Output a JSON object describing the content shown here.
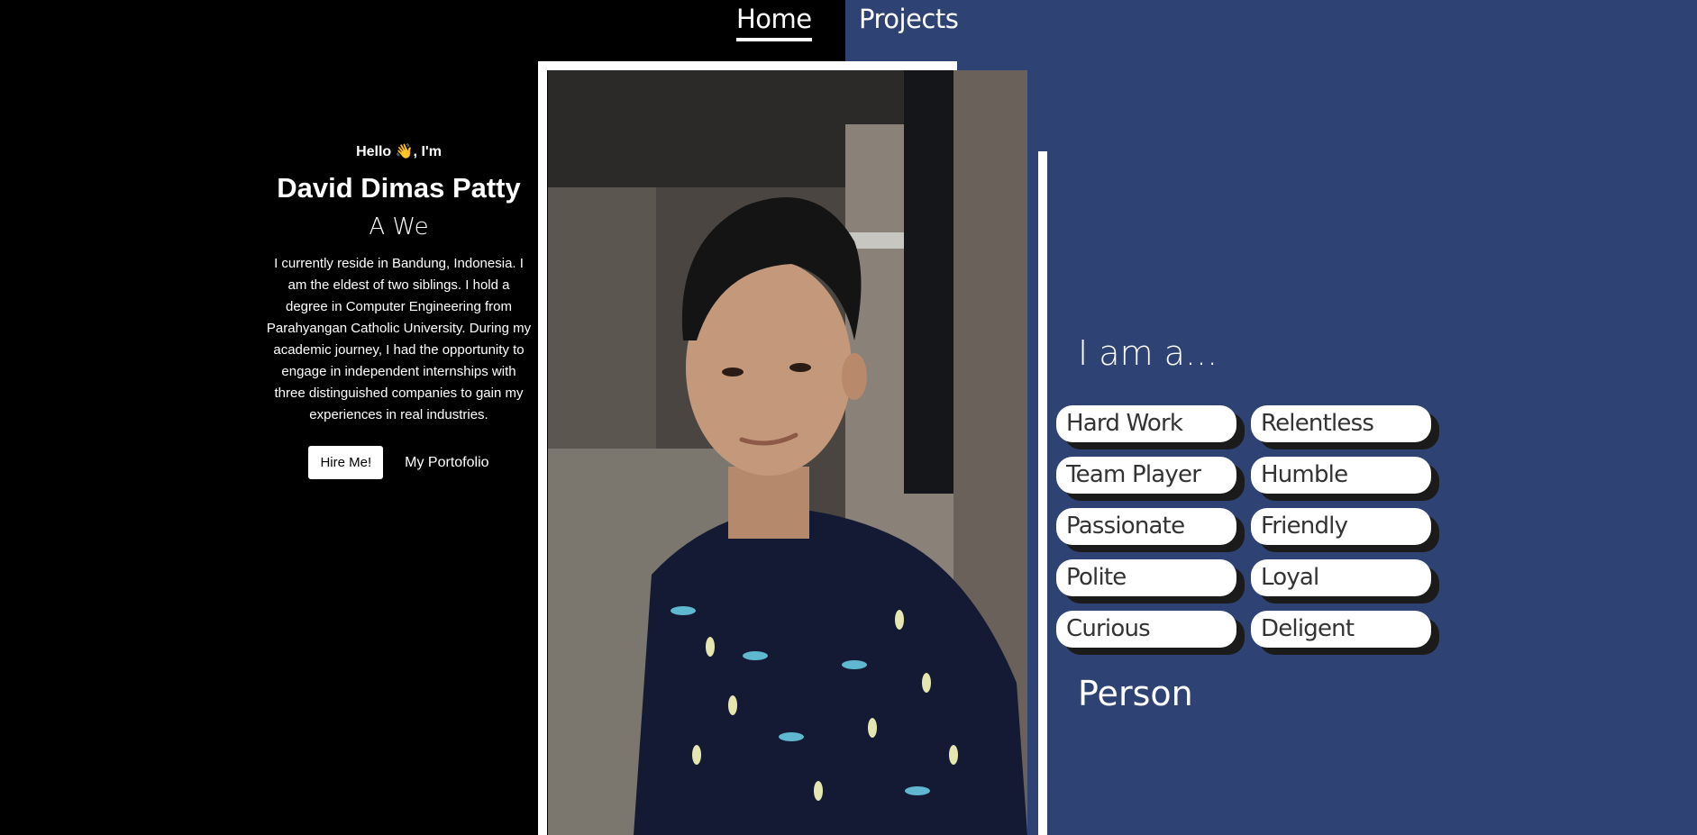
{
  "nav": {
    "home": "Home",
    "projects": "Projects"
  },
  "intro": {
    "greeting": "Hello 👋, I'm",
    "name": "David Dimas Patty",
    "role": "A We",
    "bio": "I currently reside in Bandung, Indonesia. I am the eldest of two siblings. I hold a degree in Computer Engineering from Parahyangan Catholic University. During my academic journey, I had the opportunity to engage in independent internships with three distinguished companies to gain my experiences in real industries.",
    "hire_button": "Hire Me!",
    "portfolio_link": "My Portofolio"
  },
  "traits": {
    "heading": "I am a...",
    "items": [
      "Hard Work",
      "Relentless",
      "Team Player",
      "Humble",
      "Passionate",
      "Friendly",
      "Polite",
      "Loyal",
      "Curious",
      "Deligent"
    ],
    "footer": "Person"
  },
  "colors": {
    "background_left": "#000000",
    "background_right": "#2e4274",
    "pill": "#ffffff",
    "pill_shadow": "#1b1b1b"
  }
}
